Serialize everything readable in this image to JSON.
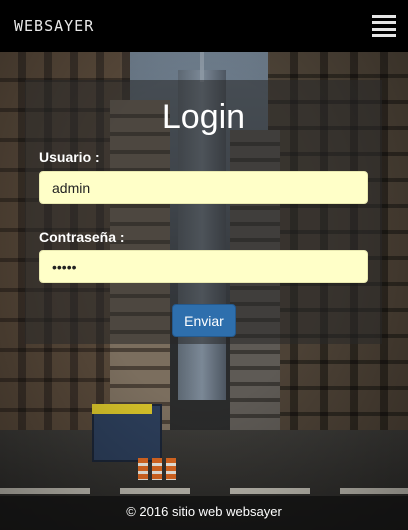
{
  "header": {
    "brand": "WEBSAYER",
    "menu_icon": "hamburger-menu-icon"
  },
  "login": {
    "title": "Login",
    "username_label": "Usuario :",
    "username_value": "admin",
    "password_label": "Contraseña :",
    "password_value": "•••••",
    "submit_label": "Enviar"
  },
  "footer": {
    "text": "© 2016 sitio web websayer"
  },
  "colors": {
    "navbar": "#000000",
    "input_background": "#ffffc8",
    "button": "#2e6fad",
    "panel_overlay": "rgba(40,40,40,0.55)"
  }
}
